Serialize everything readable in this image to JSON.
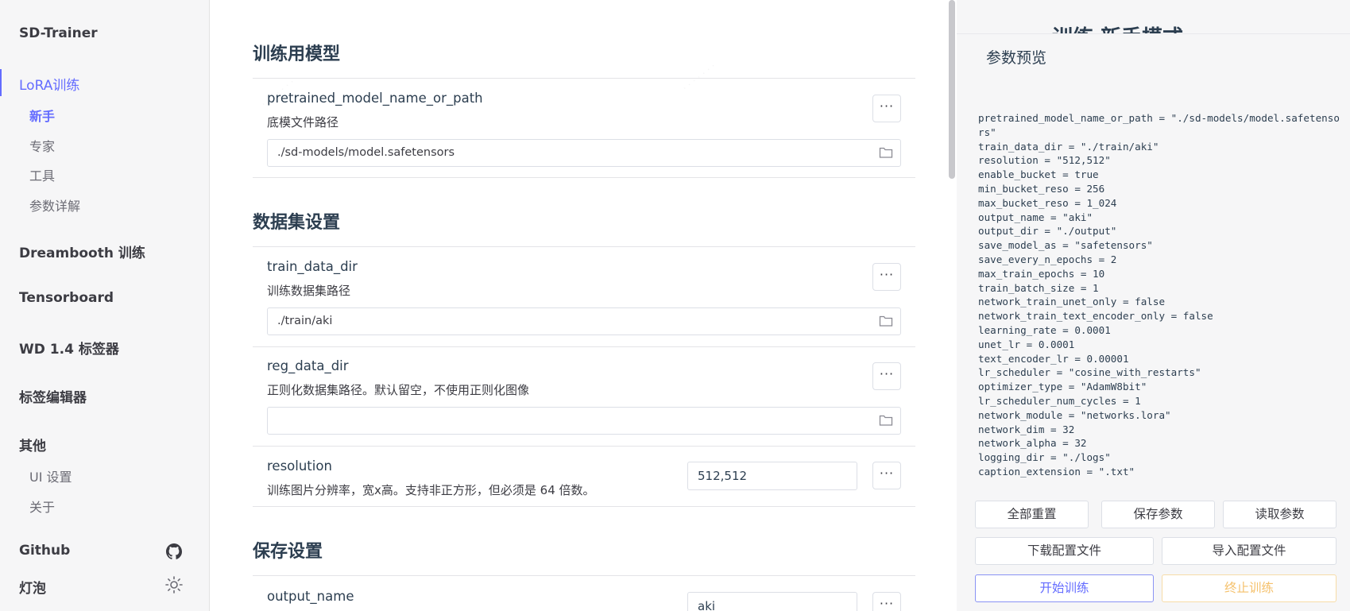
{
  "sidebar": {
    "brand": "SD-Trainer",
    "sections": {
      "lora": "LoRA训练",
      "lora_sub": [
        "新手",
        "专家",
        "工具",
        "参数详解"
      ],
      "dreambooth": "Dreambooth 训练",
      "tensorboard": "Tensorboard",
      "wd": "WD 1.4 标签器",
      "tag_editor": "标签编辑器",
      "other": "其他",
      "other_sub": [
        "UI 设置",
        "关于"
      ],
      "github": "Github",
      "theme": "灯泡"
    }
  },
  "main": {
    "sections": [
      {
        "title": "训练用模型"
      },
      {
        "title": "数据集设置"
      },
      {
        "title": "保存设置"
      }
    ],
    "items": {
      "pretrained": {
        "name": "pretrained_model_name_or_path",
        "desc": "底模文件路径",
        "value": "./sd-models/model.safetensors"
      },
      "train_data_dir": {
        "name": "train_data_dir",
        "desc": "训练数据集路径",
        "value": "./train/aki"
      },
      "reg_data_dir": {
        "name": "reg_data_dir",
        "desc": "正则化数据集路径。默认留空，不使用正则化图像",
        "value": ""
      },
      "resolution": {
        "name": "resolution",
        "desc": "训练图片分辨率，宽x高。支持非正方形，但必须是 64 倍数。",
        "value": "512,512"
      },
      "output_name": {
        "name": "output_name",
        "value": "aki"
      }
    },
    "more_label": "···"
  },
  "preview": {
    "clipped_heading": "训练 新手模式",
    "title": "参数预览",
    "code": "pretrained_model_name_or_path = \"./sd-models/model.safetensors\"\ntrain_data_dir = \"./train/aki\"\nresolution = \"512,512\"\nenable_bucket = true\nmin_bucket_reso = 256\nmax_bucket_reso = 1_024\noutput_name = \"aki\"\noutput_dir = \"./output\"\nsave_model_as = \"safetensors\"\nsave_every_n_epochs = 2\nmax_train_epochs = 10\ntrain_batch_size = 1\nnetwork_train_unet_only = false\nnetwork_train_text_encoder_only = false\nlearning_rate = 0.0001\nunet_lr = 0.0001\ntext_encoder_lr = 0.00001\nlr_scheduler = \"cosine_with_restarts\"\noptimizer_type = \"AdamW8bit\"\nlr_scheduler_num_cycles = 1\nnetwork_module = \"networks.lora\"\nnetwork_dim = 32\nnetwork_alpha = 32\nlogging_dir = \"./logs\"\ncaption_extension = \".txt\"",
    "buttons": {
      "reset_all": "全部重置",
      "save_params": "保存参数",
      "load_params": "读取参数",
      "download_config": "下载配置文件",
      "import_config": "导入配置文件",
      "start_training": "开始训练",
      "stop_training": "终止训练"
    }
  },
  "colors": {
    "accent": "#646cff",
    "warn": "#f5c16c",
    "sidebar_bg": "#f6f6f7"
  }
}
